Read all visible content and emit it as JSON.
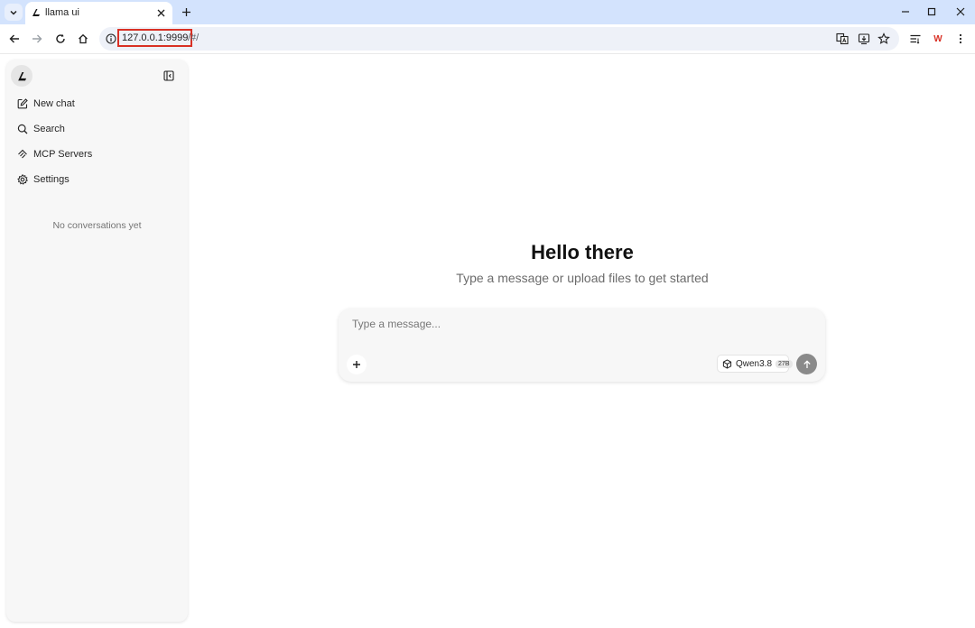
{
  "browser": {
    "tab_title": "llama ui",
    "url_host": "127.0.0.1:9999",
    "url_path": "/#/",
    "colors": {
      "tabbar": "#d3e3fd",
      "url_highlight": "#d93025"
    },
    "extension_label": "W"
  },
  "sidebar": {
    "items": [
      {
        "label": "New chat",
        "icon": "edit-icon"
      },
      {
        "label": "Search",
        "icon": "search-icon"
      },
      {
        "label": "MCP Servers",
        "icon": "mcp-icon"
      },
      {
        "label": "Settings",
        "icon": "gear-icon"
      }
    ],
    "empty_text": "No conversations yet"
  },
  "main": {
    "title": "Hello there",
    "subtitle": "Type a message or upload files to get started",
    "composer": {
      "placeholder": "Type a message...",
      "model_name": "Qwen3.8",
      "model_size": "27B"
    }
  }
}
